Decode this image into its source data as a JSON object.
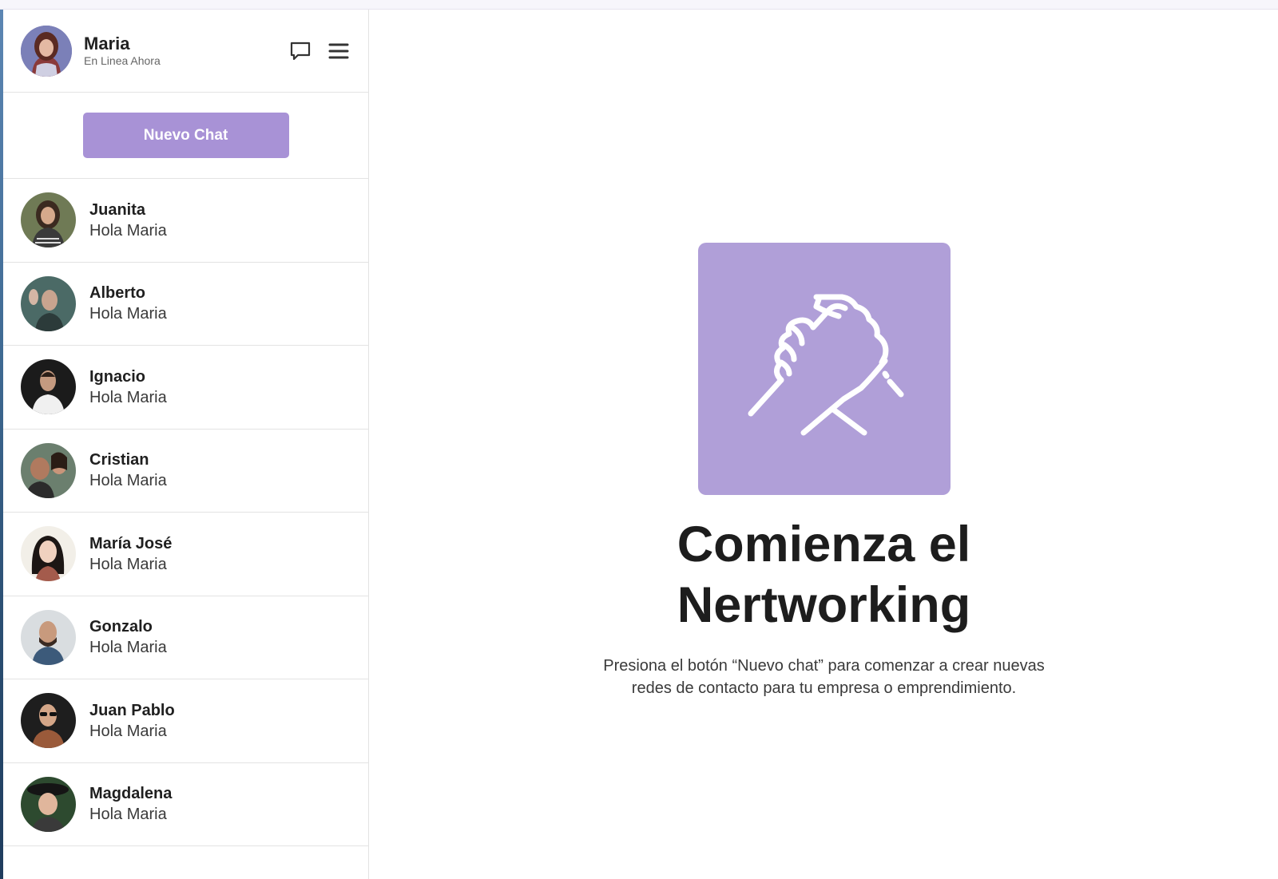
{
  "user": {
    "name": "Maria",
    "status": "En Linea Ahora"
  },
  "header_icons": [
    "chat-bubble-icon",
    "hamburger-menu-icon"
  ],
  "new_chat": {
    "label": "Nuevo Chat"
  },
  "contacts": [
    {
      "name": "Juanita",
      "message": "Hola Maria"
    },
    {
      "name": "Alberto",
      "message": "Hola Maria"
    },
    {
      "name": "Ignacio",
      "message": "Hola Maria"
    },
    {
      "name": "Cristian",
      "message": "Hola Maria"
    },
    {
      "name": "María José",
      "message": "Hola Maria"
    },
    {
      "name": "Gonzalo",
      "message": "Hola Maria"
    },
    {
      "name": "Juan Pablo",
      "message": "Hola Maria"
    },
    {
      "name": "Magdalena",
      "message": "Hola Maria"
    }
  ],
  "empty_state": {
    "icon": "handshake-icon",
    "title": "Comienza el Nertworking",
    "description": "Presiona el botón “Nuevo chat” para comenzar a crear nuevas redes de contacto para tu empresa o emprendimiento."
  },
  "colors": {
    "accent": "#a892d6",
    "tile": "#b09fd8"
  }
}
